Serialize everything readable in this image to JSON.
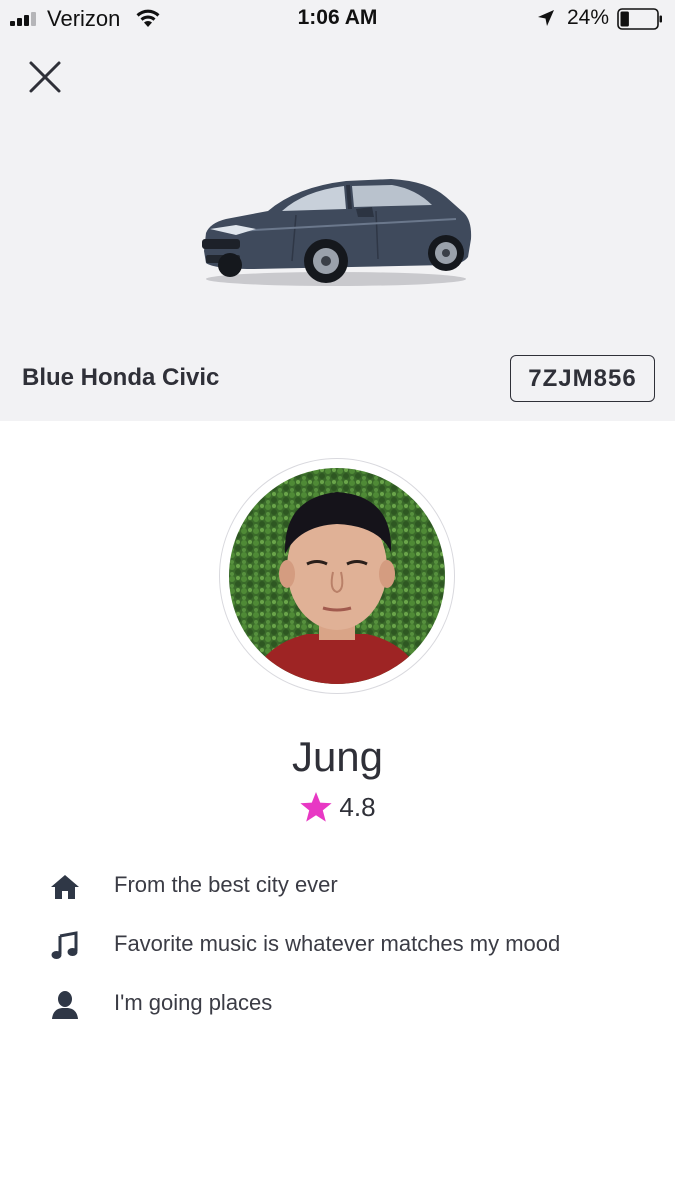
{
  "status_bar": {
    "carrier": "Verizon",
    "time": "1:06 AM",
    "battery_percent": "24%",
    "battery_level": 0.24,
    "signal_bars_filled": 3,
    "signal_bars_total": 4
  },
  "car": {
    "description": "Blue Honda Civic",
    "plate": "7ZJM856",
    "color": "#3f4a5c"
  },
  "driver": {
    "name": "Jung",
    "rating": "4.8",
    "facts": [
      {
        "icon": "home-icon",
        "text": "From the best city ever"
      },
      {
        "icon": "music-note-icon",
        "text": "Favorite music is whatever matches my mood"
      },
      {
        "icon": "person-icon",
        "text": "I'm going places"
      }
    ]
  },
  "colors": {
    "accent_star": "#e838c4",
    "header_bg": "#f2f2f4",
    "text_dark": "#2f3038"
  }
}
